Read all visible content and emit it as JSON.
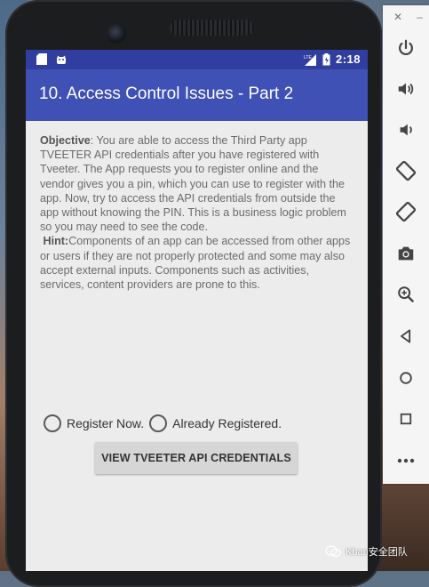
{
  "status_bar": {
    "time": "2:18",
    "network": "LTE"
  },
  "app_bar": {
    "title": "10. Access Control Issues - Part 2"
  },
  "description": {
    "objective_label": "Objective",
    "objective_text": ": You are able to access the Third Party app TVEETER API credentials after you have registered with Tveeter. The App requests you to register online and the vendor gives you a pin, which you can use to register with the app. Now, try to access the API credentials from outside the app without knowing the PIN. This is a business logic problem so you may need to see the code.",
    "hint_label": "Hint:",
    "hint_text": "Components of an app can be accessed from other apps or users if they are not properly protected and some may also accept external inputs. Components such as activities, services, content providers are prone to this."
  },
  "radios": [
    {
      "label": "Register Now.",
      "checked": false
    },
    {
      "label": "Already Registered.",
      "checked": false
    }
  ],
  "view_button": {
    "label": "VIEW TVEETER API CREDENTIALS"
  },
  "emulator_toolbar": {
    "close_glyph": "✕",
    "minimize_glyph": "–",
    "tools": [
      "power-icon",
      "volume-up-icon",
      "volume-down-icon",
      "rotate-left-icon",
      "rotate-right-icon",
      "camera-icon",
      "zoom-icon",
      "back-icon",
      "home-icon",
      "overview-icon",
      "more-icon"
    ]
  },
  "watermark": {
    "text": "Khan安全团队"
  },
  "colors": {
    "status_bar": "#303f9f",
    "app_bar": "#3f51b5",
    "screen_bg": "#ececec",
    "button_bg": "#d6d6d6"
  }
}
